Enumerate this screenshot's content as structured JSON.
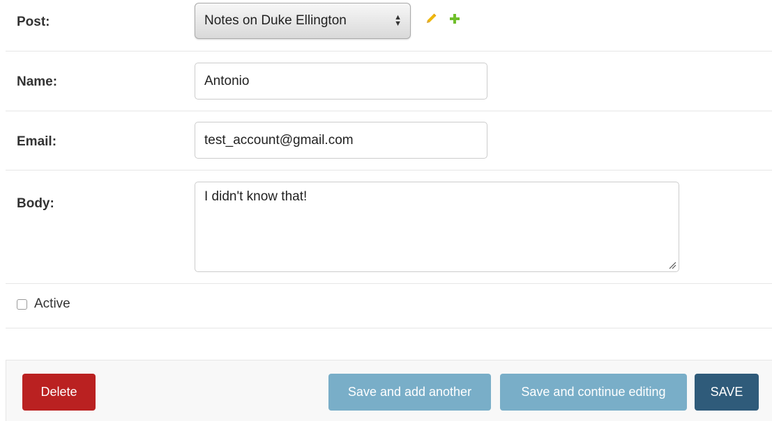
{
  "form": {
    "post": {
      "label": "Post:",
      "selected": "Notes on Duke Ellington",
      "arrow_up": "▲",
      "arrow_down": "▼"
    },
    "name": {
      "label": "Name:",
      "value": "Antonio"
    },
    "email": {
      "label": "Email:",
      "value": "test_account@gmail.com"
    },
    "body": {
      "label": "Body:",
      "value": "I didn't know that!"
    },
    "active": {
      "label": "Active",
      "checked": false
    }
  },
  "actions": {
    "delete_label": "Delete",
    "save_add_another_label": "Save and add another",
    "save_continue_label": "Save and continue editing",
    "save_label": "SAVE"
  },
  "colors": {
    "delete": "#ba2121",
    "secondary": "#79aec8",
    "save": "#2f5b7a",
    "pencil": "#efb80b",
    "plus": "#70bf2b"
  }
}
